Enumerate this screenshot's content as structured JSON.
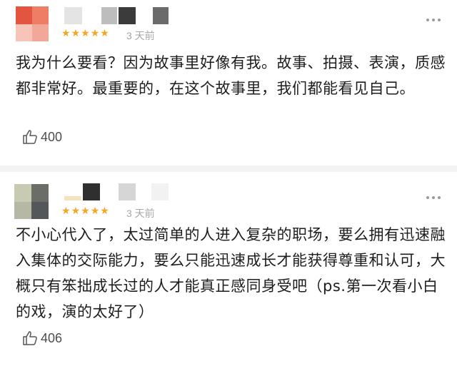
{
  "reviews": [
    {
      "rating": 5,
      "stars": [
        "★",
        "★",
        "★",
        "★",
        "★"
      ],
      "time": "3 天前",
      "text": "我为什么要看？因为故事里好像有我。故事、拍摄、表演，质感都非常好。最重要的，在这个故事里，我们都能看见自己。",
      "likes": "400"
    },
    {
      "rating": 5,
      "stars": [
        "★",
        "★",
        "★",
        "★",
        "★"
      ],
      "time": "3 天前",
      "text": "不小心代入了，太过简单的人进入复杂的职场，要么拥有迅速融入集体的交际能力，要么只能迅速成长才能获得尊重和认可，大概只有笨拙成长过的人才能真正感同身受吧（ps.第一次看小白的戏，演的太好了）",
      "likes": "406"
    }
  ],
  "colors": {
    "star": "#f5a623",
    "muted": "#a8a8a8",
    "divider": "#f3f3f3"
  },
  "icons": {
    "like": "thumbs-up-icon",
    "more": "more-dots-icon"
  }
}
